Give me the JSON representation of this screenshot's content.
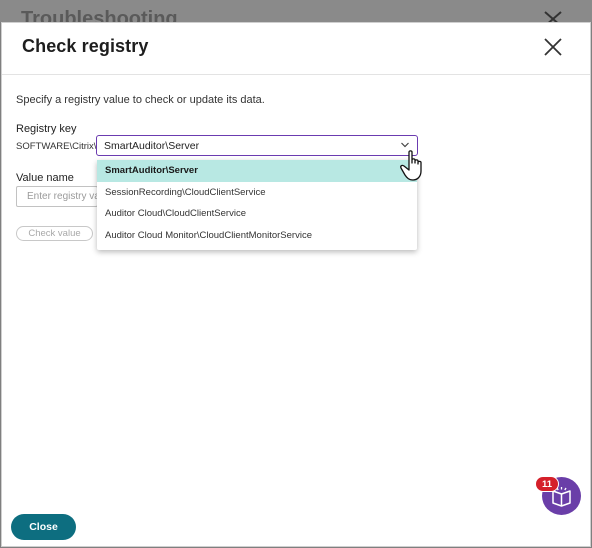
{
  "background": {
    "title": "Troubleshooting"
  },
  "modal": {
    "title": "Check registry",
    "description": "Specify a registry value to check or update its data."
  },
  "registry_key": {
    "label": "Registry key",
    "prefix": "SOFTWARE\\Citrix\\",
    "selected": "SmartAuditor\\Server",
    "options": [
      "SmartAuditor\\Server",
      "SessionRecording\\CloudClientService",
      "Auditor Cloud\\CloudClientService",
      "Auditor Cloud Monitor\\CloudClientMonitorService"
    ]
  },
  "value_name": {
    "label": "Value name",
    "placeholder": "Enter registry value"
  },
  "buttons": {
    "check_value": "Check value",
    "close": "Close"
  },
  "help": {
    "badge_count": "11"
  },
  "colors": {
    "accent_purple": "#6b3bb0",
    "primary_teal": "#0d6e80",
    "selected_option_bg": "#b8e8e3",
    "badge_red": "#d5202a"
  }
}
